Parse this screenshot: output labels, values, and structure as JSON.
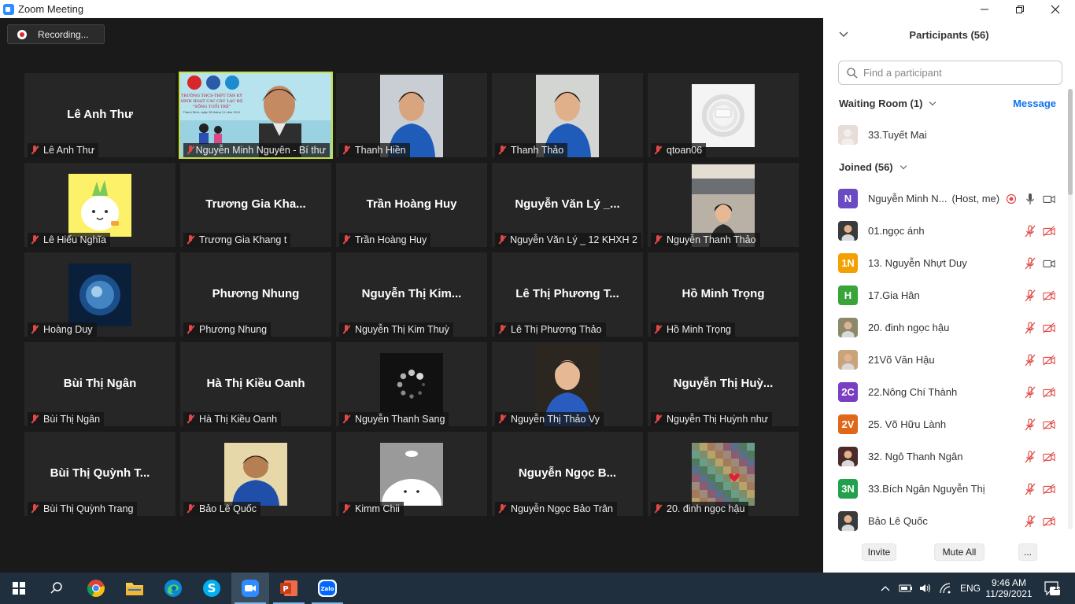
{
  "window": {
    "title": "Zoom Meeting"
  },
  "recording": {
    "label": "Recording..."
  },
  "tiles": [
    {
      "display": "Lê Anh Thư",
      "tag": "Lê Anh Thư",
      "kind": "name"
    },
    {
      "display": "",
      "tag": "Nguyễn Minh Nguyên - Bí thư",
      "kind": "banner",
      "active": true,
      "banner_lines": [
        "TRƯỜNG THCS-THPT TÂN KỲ",
        "SINH HOẠT CÁC CÂU LẠC BỘ",
        "\"SỐNG TUỔI TRẺ\"",
        "Thanh Đình, ngày 28 tháng 11 năm 2021"
      ]
    },
    {
      "display": "",
      "tag": "Thanh Hiền",
      "kind": "person",
      "shirt": "#1f5bb8",
      "skin": "#d9a57f",
      "bg": "#c9ced4"
    },
    {
      "display": "",
      "tag": "Thanh Thảo",
      "kind": "person",
      "shirt": "#1f5bb8",
      "skin": "#e0b08a",
      "bg": "#d3d5d3"
    },
    {
      "display": "",
      "tag": "qtoan06",
      "kind": "cable"
    },
    {
      "display": "",
      "tag": "Lê Hiếu Nghĩa",
      "kind": "pineapple"
    },
    {
      "display": "Trương Gia Kha...",
      "tag": "Trương Gia Khang t",
      "kind": "name"
    },
    {
      "display": "Trần Hoàng Huy",
      "tag": "Trần Hoàng Huy",
      "kind": "name"
    },
    {
      "display": "Nguyễn Văn Lý _...",
      "tag": "Nguyễn Văn Lý _ 12 KHXH 2",
      "kind": "name"
    },
    {
      "display": "",
      "tag": "Nguyễn Thanh Thảo",
      "kind": "room"
    },
    {
      "display": "",
      "tag": "Hoàng Duy",
      "kind": "orb"
    },
    {
      "display": "Phương Nhung",
      "tag": "Phương Nhung",
      "kind": "name"
    },
    {
      "display": "Nguyễn Thị Kim...",
      "tag": "Nguyễn Thị Kim Thuỳ",
      "kind": "name"
    },
    {
      "display": "Lê Thị Phương T...",
      "tag": "Lê Thị Phương Thảo",
      "kind": "name"
    },
    {
      "display": "Hồ Minh Trọng",
      "tag": "Hồ Minh Trọng",
      "kind": "name"
    },
    {
      "display": "Bùi Thị Ngân",
      "tag": "Bùi Thị Ngân",
      "kind": "name"
    },
    {
      "display": "Hà Thị Kiều Oanh",
      "tag": "Hà Thị Kiều Oanh",
      "kind": "name"
    },
    {
      "display": "",
      "tag": "Nguyễn Thanh Sang",
      "kind": "loading"
    },
    {
      "display": "",
      "tag": "Nguyễn Thị Thảo Vy",
      "kind": "dark-person"
    },
    {
      "display": "Nguyễn Thị Huỳ...",
      "tag": "Nguyễn Thị Huỳnh như",
      "kind": "name"
    },
    {
      "display": "Bùi Thị Quỳnh T...",
      "tag": "Bùi Thị Quỳnh Trang",
      "kind": "name"
    },
    {
      "display": "",
      "tag": "Bảo Lê Quốc",
      "kind": "boy"
    },
    {
      "display": "",
      "tag": "Kimm Chii",
      "kind": "cloud"
    },
    {
      "display": "Nguyễn Ngọc B...",
      "tag": "Nguyễn Ngọc Bảo Trân",
      "kind": "name"
    },
    {
      "display": "",
      "tag": "20. đinh ngọc hậu",
      "kind": "collage"
    }
  ],
  "panel": {
    "title": "Participants (56)",
    "search_placeholder": "Find a participant",
    "waiting_room": "Waiting Room (1)",
    "message": "Message",
    "waiting": [
      {
        "name": "33.Tuyết Mai",
        "avatar_color": "#e6dcd8"
      }
    ],
    "joined": "Joined (56)",
    "participants": [
      {
        "name": "Nguyễn Minh N...",
        "role": "(Host, me)",
        "initials": "N",
        "color": "#6a4bc4",
        "host": true
      },
      {
        "name": "01.ngọc ánh",
        "initials": "",
        "color": "#3a3a3a"
      },
      {
        "name": "13. Nguyễn Nhựt Duy",
        "initials": "1N",
        "color": "#f3a000",
        "video_on": true
      },
      {
        "name": "17.Gia Hân",
        "initials": "H",
        "color": "#3aa33a"
      },
      {
        "name": "20. đinh ngọc hậu",
        "initials": "",
        "color": "#8a8a6a"
      },
      {
        "name": "21Võ Văn Hậu",
        "initials": "",
        "color": "#c9a37c"
      },
      {
        "name": "22.Nông Chí Thành",
        "initials": "2C",
        "color": "#7a3fc0"
      },
      {
        "name": "25. Võ Hữu Lành",
        "initials": "2V",
        "color": "#e0661a"
      },
      {
        "name": "32. Ngô Thanh Ngân",
        "initials": "",
        "color": "#4a2a2a"
      },
      {
        "name": "33.Bích Ngân Nguyễn Thị",
        "initials": "3N",
        "color": "#21a04d"
      },
      {
        "name": "Bảo Lê Quốc",
        "initials": "",
        "color": "#3a3a3a"
      }
    ],
    "buttons": {
      "invite": "Invite",
      "mute_all": "Mute All",
      "more": "..."
    }
  },
  "taskbar": {
    "lang": "ENG",
    "time": "9:46 AM",
    "date": "11/29/2021",
    "notif_count": "13"
  }
}
